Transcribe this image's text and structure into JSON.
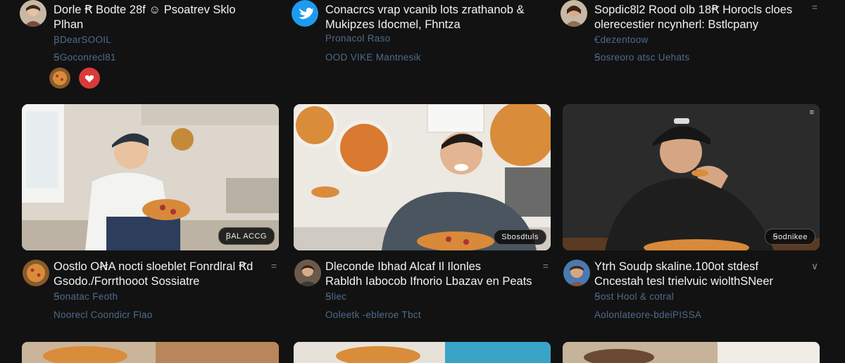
{
  "posts": [
    {
      "title_line1": "Dorle Ꞧ Bodte 28f ☺ Psoatrev Sklo",
      "title_line2": "Plhan",
      "sub1": "ꞴDearSOOIL",
      "sub2": "ꞨGoconrecl81",
      "reactions": [
        "food-reaction-icon",
        "heart-reaction-icon"
      ]
    },
    {
      "title_line1": "Conacrcs vrap vcanib lots zrathanob &",
      "title_line2": "Mukipzes Idocmel, Fhntza",
      "sub1": "Pronacol Raso",
      "sub2": "OOD VIKE Mantnesik",
      "avatar_icon": "twitter-bird-icon"
    },
    {
      "title_line1": "Sopdic8l2 Rood olb 18Ꞧ Horocls cloes",
      "title_line2": "olerecestier ncynherl: Bstlcpany",
      "sub1": "Ꞓdezentoow",
      "sub2": "Ꞩosreoro atsc Uehats"
    }
  ],
  "cards": [
    {
      "badge": "ꞴAL ACCG",
      "scene": "kitchen-woman-pizza"
    },
    {
      "badge": "Sbosdtuls",
      "scene": "man-pizza-wall"
    },
    {
      "badge": "Ꞩodnikee",
      "scene": "man-eating-dark"
    }
  ],
  "metas": [
    {
      "title_line1": "Oostlo OꞤA nocti sloeblet Fonrdlral Ꞧd",
      "title_line2": "Gsodo./Forrthooot Sossiatre",
      "sub1": "Ꞩonatac Feoth",
      "sub2": "Noorecl Coondicr Flao"
    },
    {
      "title_line1": "Dleconde Ibhad Alcaf Il Ilonles",
      "title_line2": "Rabldh Iabocob Ifnorio Lbazav en Peats",
      "sub1": "Ꞩliec",
      "sub2": "Ooleetk -ebleroe Tbct"
    },
    {
      "title_line1": "Ytrh Soudp skaline.100ot stdesf",
      "title_line2": "Cncestah tesl trielvuic wiolthSNeer",
      "sub1": "Ꞩost Hool & cotral",
      "sub2": "Aolonlateore-bdeiPISSA"
    }
  ],
  "menu_glyph": "=",
  "meta_menu_glyph_3": "∨",
  "card_menu_glyph": "≡",
  "colors": {
    "background": "#121212",
    "subtext": "#4f6c8a",
    "twitter": "#1d9bf0",
    "heart_reaction": "#d93a3a"
  }
}
